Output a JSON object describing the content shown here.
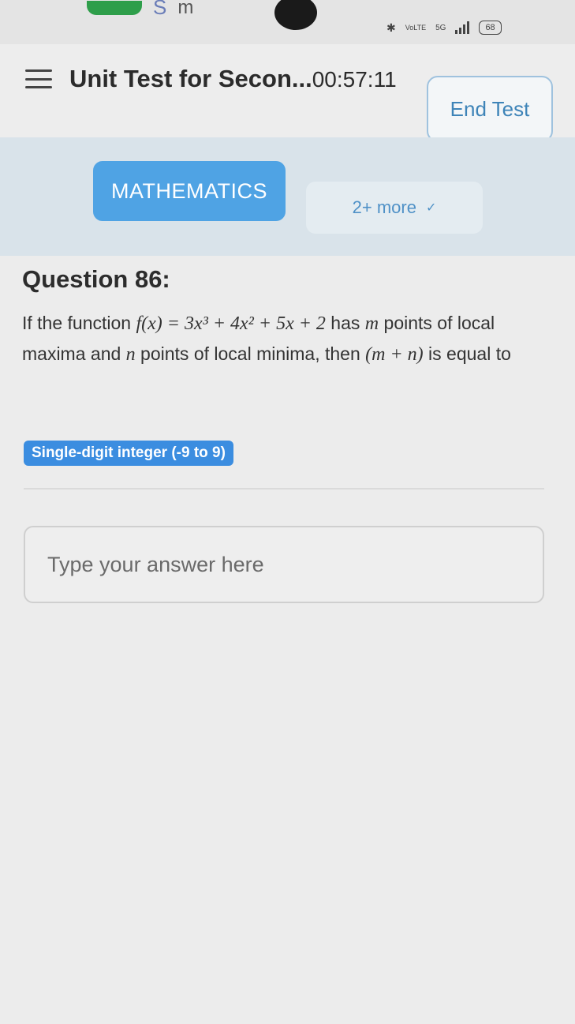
{
  "statusbar": {
    "left_m": "m",
    "network_label": "VoLTE",
    "network_type": "5G",
    "battery": "68",
    "icons": [
      "app-pill-icon",
      "subscript-s-icon",
      "bluetooth-icon",
      "volte-icon",
      "5g-signal-icon",
      "signal-bars-icon",
      "battery-icon"
    ]
  },
  "header": {
    "title": "Unit Test for Secon...",
    "timer": "00:57:11",
    "end_label": "End Test"
  },
  "subjects": {
    "active": "MATHEMATICS",
    "more": "2+ more"
  },
  "question": {
    "title": "Question 86:",
    "text_before": "If the function ",
    "text_after": " has ",
    "text_m_points": " points of local maxima and ",
    "text_n_points": " points of local minima, then ",
    "text_end": " is equal to",
    "func": "f(x) = 3x³ + 4x² + 5x + 2",
    "var_m": "m",
    "var_n": "n",
    "expr": "(m + n)"
  },
  "answer_type": "Single-digit integer (-9 to 9)",
  "answer": {
    "placeholder": "Type your answer here",
    "value": ""
  },
  "colors": {
    "accent": "#4fa3e4",
    "badge": "#3b8de0",
    "subject_band": "#d9e3ea",
    "end_border": "#9fc2de"
  }
}
